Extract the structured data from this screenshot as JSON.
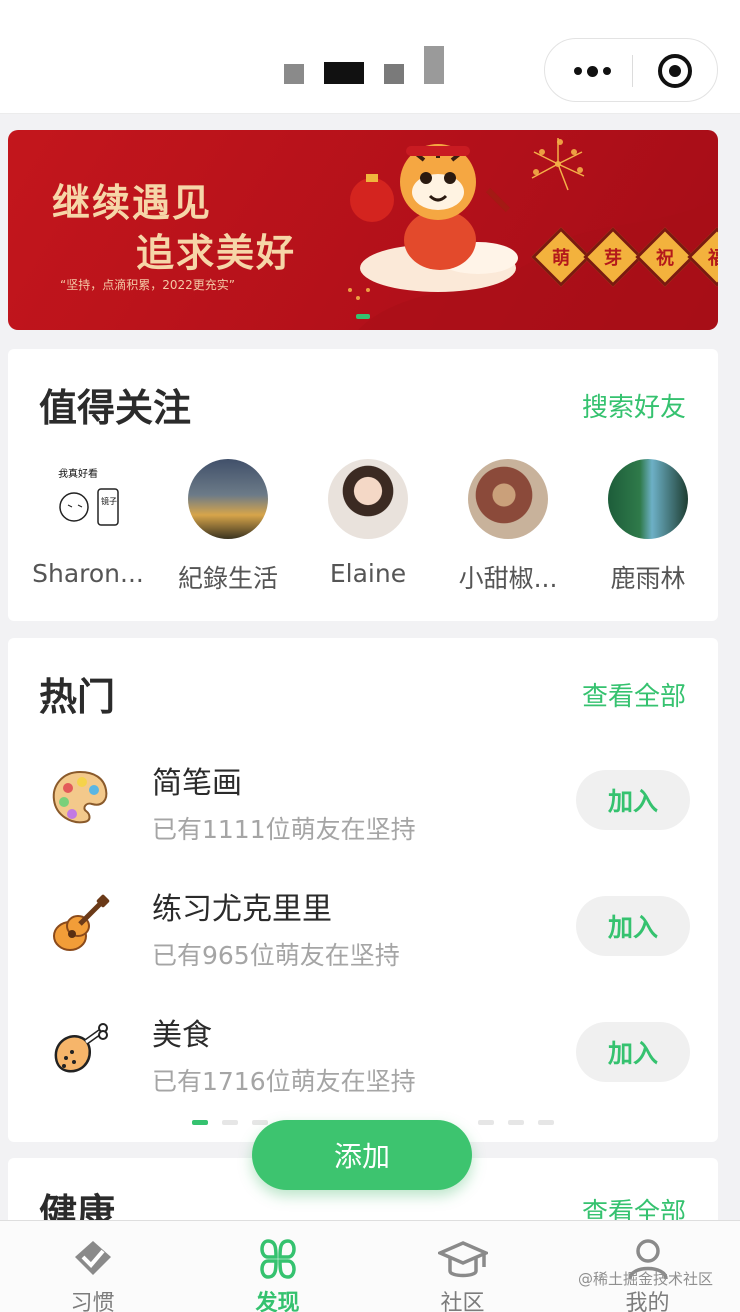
{
  "header": {
    "menu_icon": "more-dots-icon",
    "close_icon": "target-circle-icon"
  },
  "banner": {
    "line1": "继续遇见",
    "line2": "追求美好",
    "subtitle": "“坚持，点滴积累，2022更充实”",
    "tags": [
      "萌",
      "芽",
      "祝",
      "福"
    ]
  },
  "follow": {
    "title": "值得关注",
    "link": "搜索好友",
    "users": [
      {
        "name": "Sharon..."
      },
      {
        "name": "紀錄生活"
      },
      {
        "name": "Elaine"
      },
      {
        "name": "小甜椒..."
      },
      {
        "name": "鹿雨林"
      }
    ],
    "avatar1_text": [
      "我真好看",
      "镜子"
    ]
  },
  "hot": {
    "title": "热门",
    "link": "查看全部",
    "items": [
      {
        "title": "简笔画",
        "subtitle": "已有1111位萌友在坚持",
        "button": "加入",
        "icon": "palette-icon"
      },
      {
        "title": "练习尤克里里",
        "subtitle": "已有965位萌友在坚持",
        "button": "加入",
        "icon": "ukulele-icon"
      },
      {
        "title": "美食",
        "subtitle": "已有1716位萌友在坚持",
        "button": "加入",
        "icon": "drumstick-icon"
      }
    ]
  },
  "health": {
    "title": "健康",
    "link": "查看全部"
  },
  "add_button": "添加",
  "tabs": [
    {
      "label": "习惯",
      "icon": "habit-icon"
    },
    {
      "label": "发现",
      "icon": "discover-icon",
      "active": true
    },
    {
      "label": "社区",
      "icon": "community-icon"
    },
    {
      "label": "我的",
      "icon": "profile-icon"
    }
  ],
  "watermark": "@稀土掘金技术社区",
  "colors": {
    "accent": "#35c26f",
    "banner_red": "#c3161c",
    "banner_text": "#f6d6a8"
  }
}
